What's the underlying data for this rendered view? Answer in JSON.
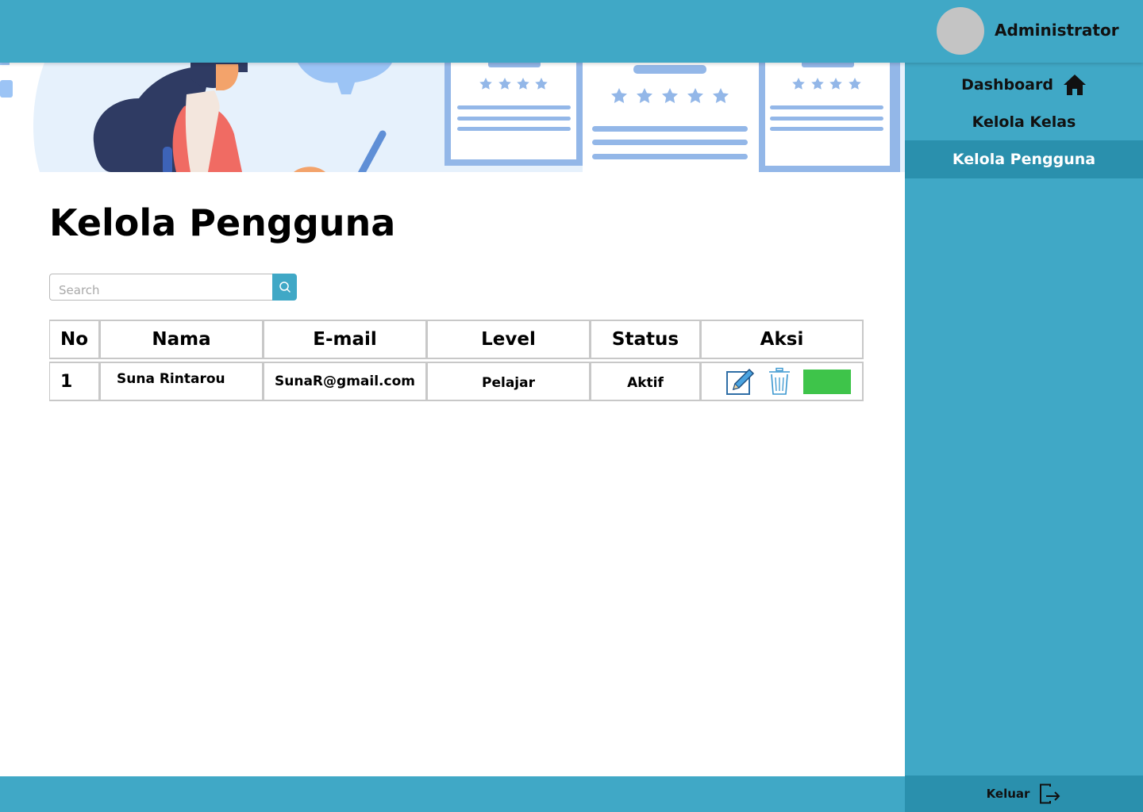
{
  "header": {
    "user_name": "Administrator"
  },
  "sidebar": {
    "items": [
      {
        "label": "Dashboard",
        "icon": "home-icon",
        "active": false
      },
      {
        "label": "Kelola Kelas",
        "active": false
      },
      {
        "label": "Kelola Pengguna",
        "active": true
      }
    ],
    "logout_label": "Keluar",
    "logout_icon": "logout-icon"
  },
  "page": {
    "title": "Kelola Pengguna"
  },
  "search": {
    "placeholder": "Search",
    "icon": "search-icon"
  },
  "table": {
    "headers": [
      "No",
      "Nama",
      "E-mail",
      "Level",
      "Status",
      "Aksi"
    ],
    "rows": [
      {
        "no": "1",
        "nama": "Suna Rintarou",
        "email": "SunaR@gmail.com",
        "level": "Pelajar",
        "status": "Aktif"
      }
    ],
    "actions": {
      "edit_icon": "edit-icon",
      "delete_icon": "trash-icon",
      "toggle_color": "#3ec44a"
    }
  },
  "colors": {
    "primary": "#40a8c6",
    "primary_dark": "#2a90ad",
    "banner_bg": "#e6f1fc",
    "illustration_blue": "#93b7e8"
  }
}
